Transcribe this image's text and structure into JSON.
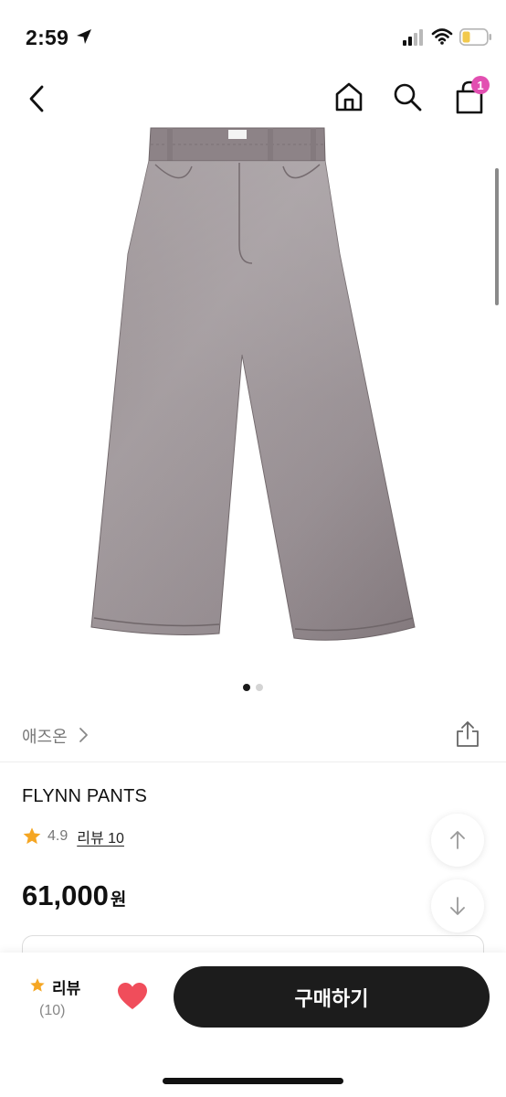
{
  "status_bar": {
    "time": "2:59",
    "battery_color": "#f2c94c"
  },
  "nav": {
    "back_icon": "chevron-left-icon",
    "home_icon": "home-icon",
    "search_icon": "search-icon",
    "cart_icon": "shopping-bag-icon",
    "cart_badge": "1",
    "badge_color": "#e24fb1"
  },
  "gallery": {
    "image": "wide-leg-grey-jeans",
    "pages": 2,
    "active_page": 1
  },
  "product": {
    "brand": "애즈온",
    "name": "FLYNN PANTS",
    "rating": "4.9",
    "review_link": "리뷰 10",
    "price": "61,000",
    "currency": "원"
  },
  "floating": {
    "up_icon": "arrow-up-icon",
    "down_icon": "arrow-down-icon"
  },
  "bottom_bar": {
    "review_label": "리뷰",
    "review_count": "(10)",
    "wish_icon": "heart-icon",
    "wish_color": "#f04d5b",
    "buy_label": "구매하기"
  },
  "colors": {
    "star": "#f5a623",
    "accent_dark": "#1c1c1c"
  }
}
